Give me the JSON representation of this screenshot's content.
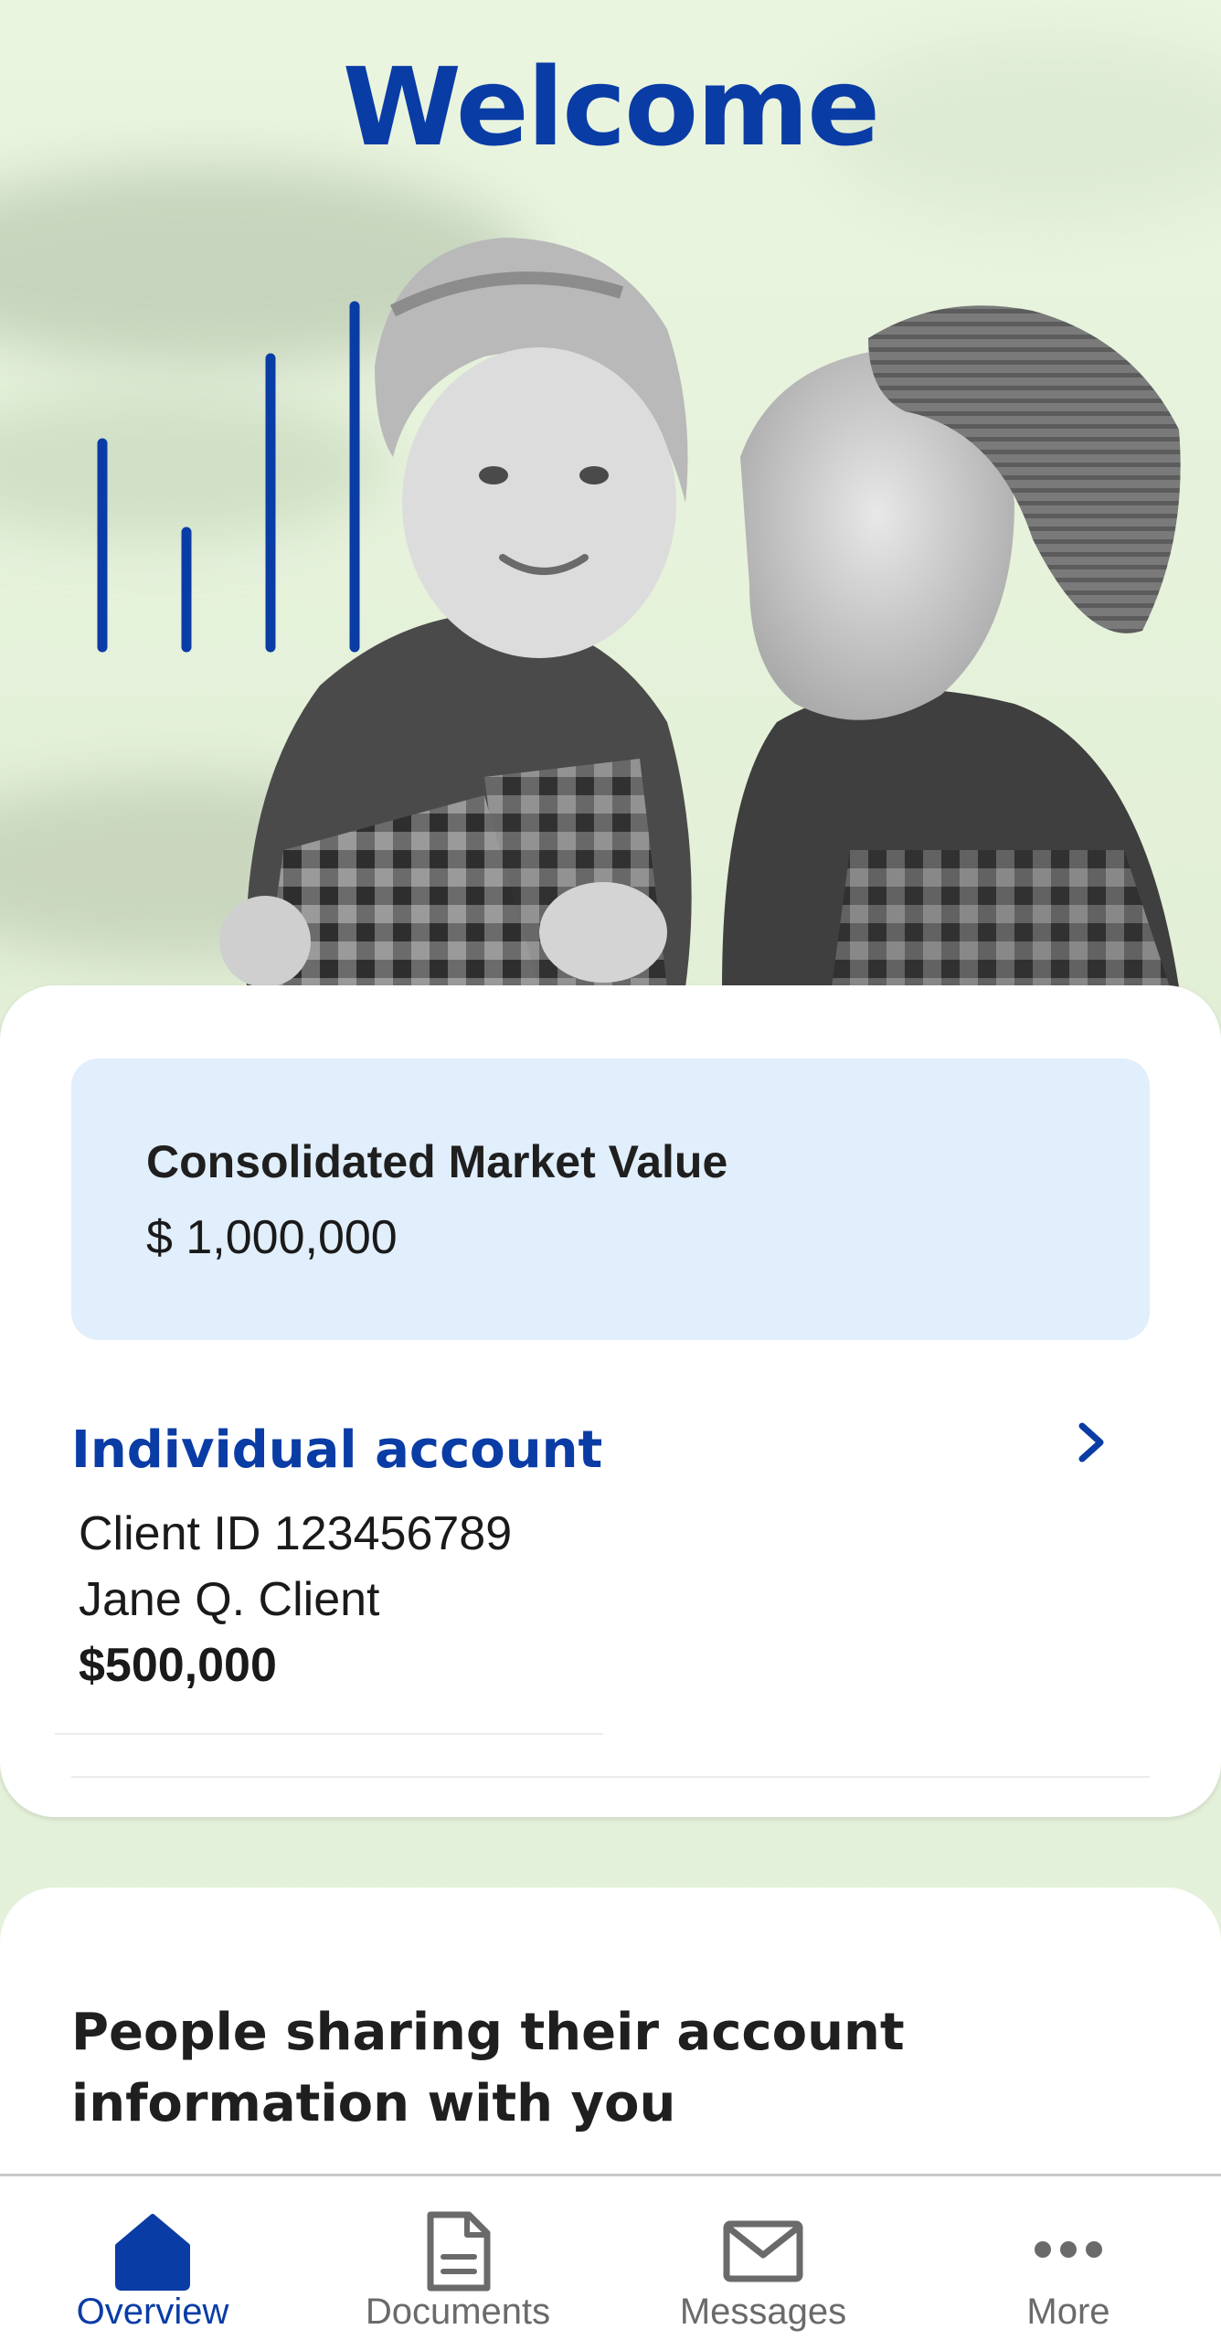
{
  "hero": {
    "title": "Welcome",
    "accent_color": "#0a3ca5"
  },
  "summary": {
    "label": "Consolidated Market Value",
    "value": "$ 1,000,000"
  },
  "account": {
    "title": "Individual account",
    "client_id": "Client ID 123456789",
    "name": "Jane Q. Client",
    "balance": "$500,000",
    "chevron_icon": "chevron-right-icon"
  },
  "sharing": {
    "title": "People sharing their account information with you"
  },
  "bottom_nav": {
    "items": [
      {
        "label": "Overview",
        "icon": "home-icon",
        "active": true
      },
      {
        "label": "Documents",
        "icon": "document-icon",
        "active": false
      },
      {
        "label": "Messages",
        "icon": "mail-icon",
        "active": false
      },
      {
        "label": "More",
        "icon": "more-icon",
        "active": false
      }
    ]
  }
}
